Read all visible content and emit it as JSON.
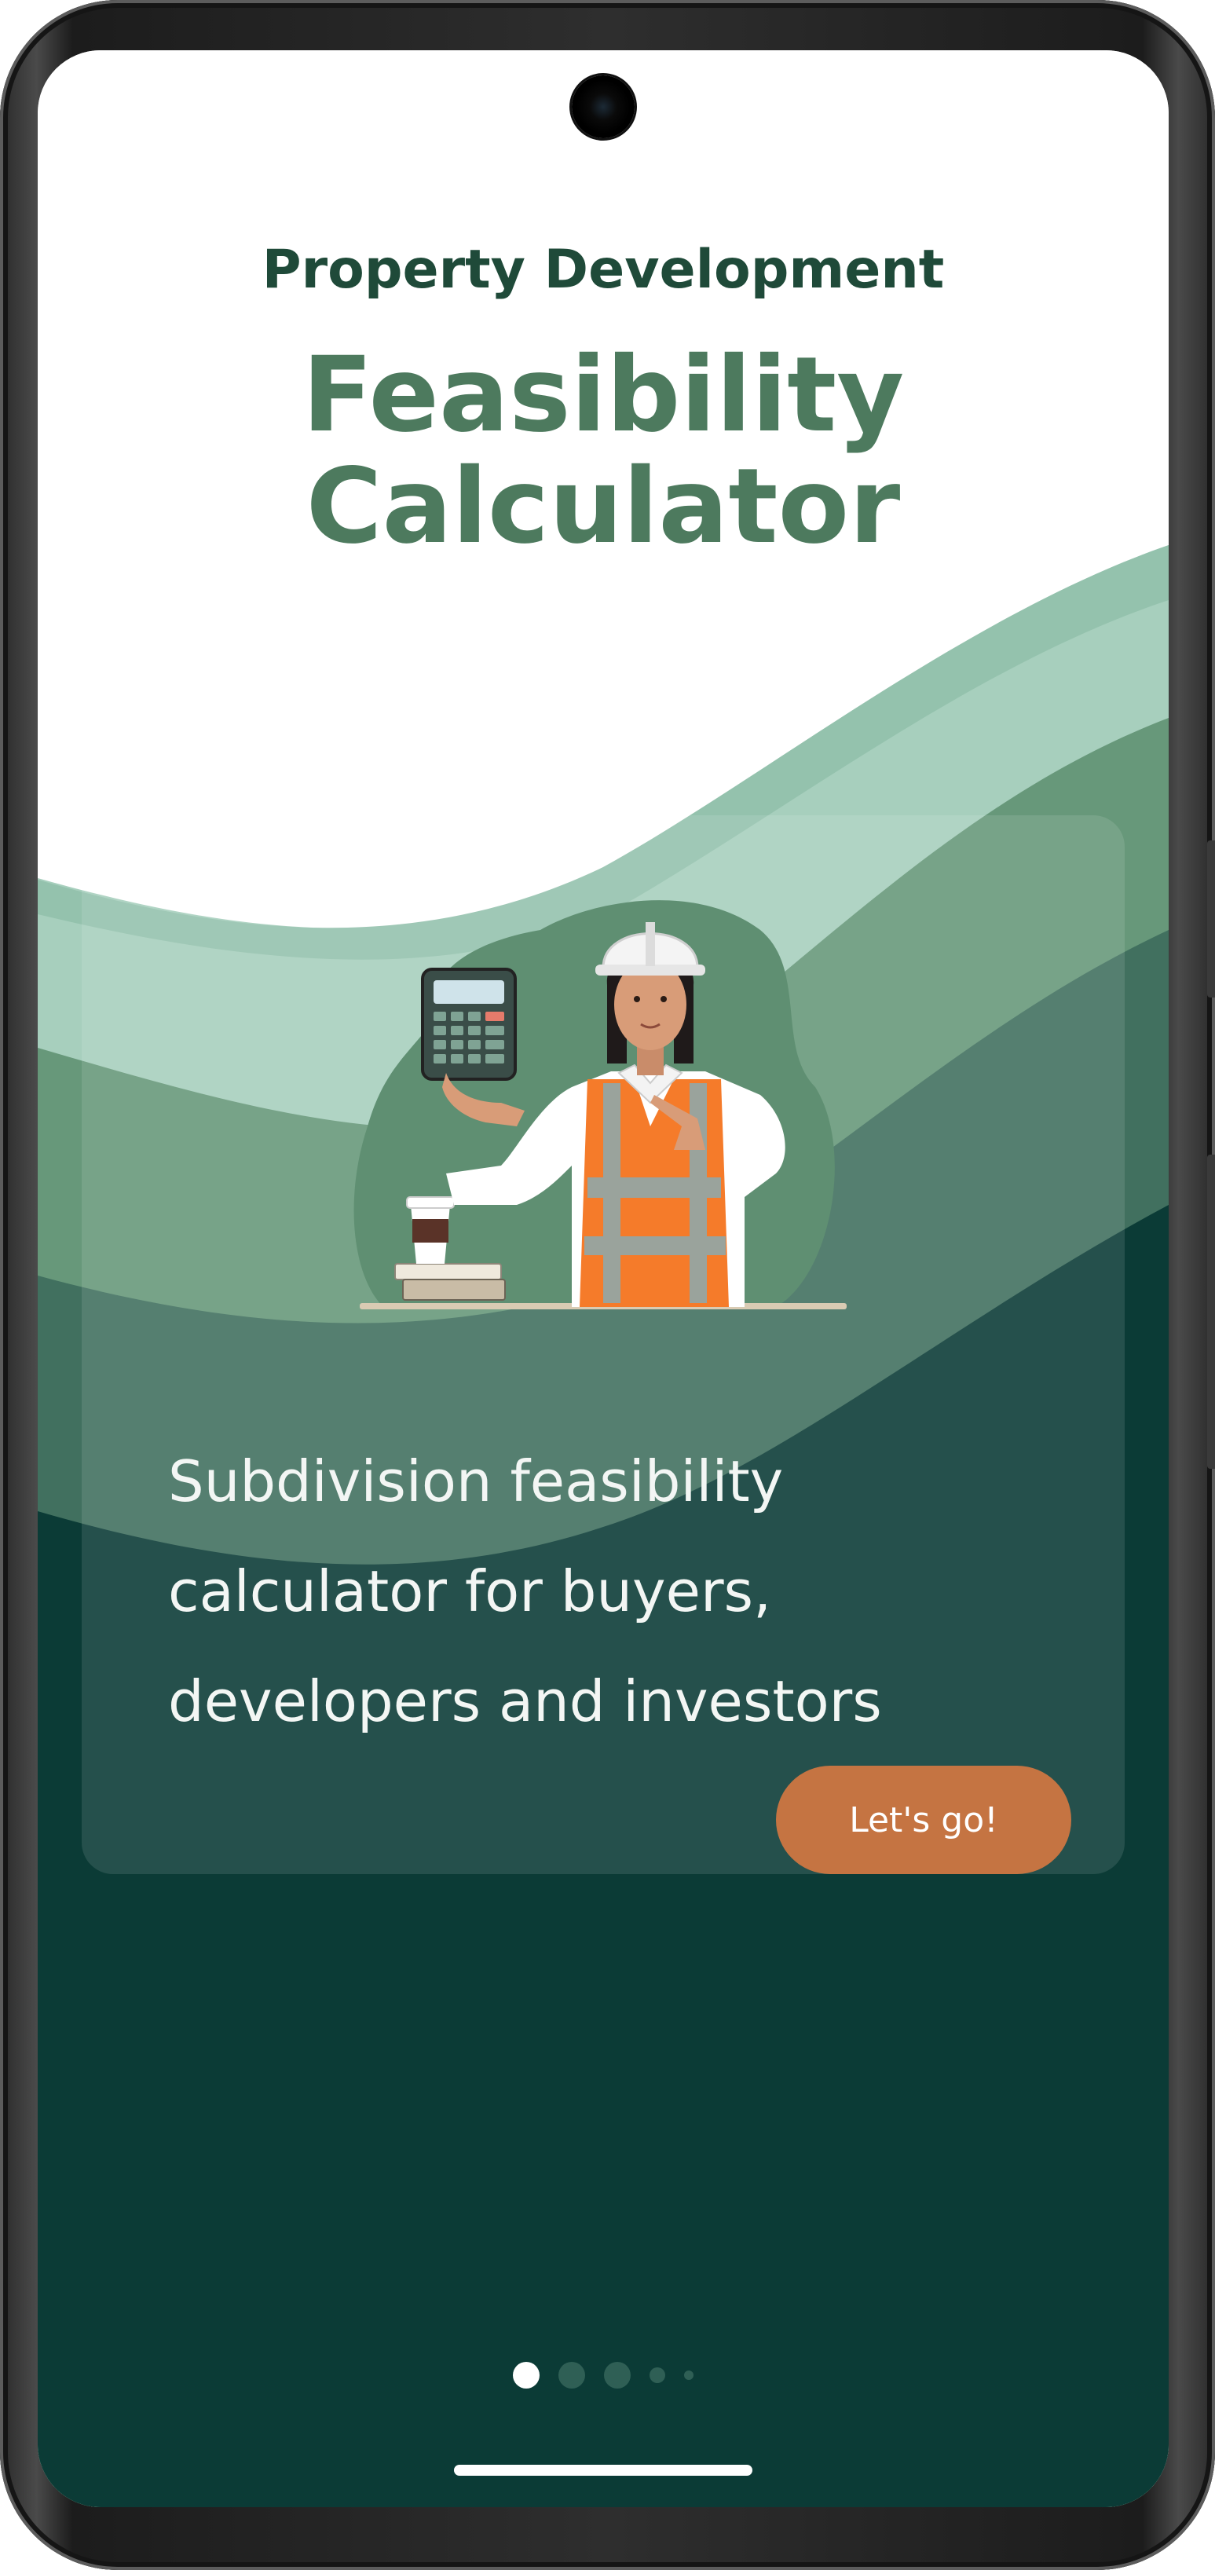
{
  "header": {
    "subtitle": "Property Development",
    "title_line1": "Feasibility",
    "title_line2": "Calculator"
  },
  "main": {
    "description_lines": [
      "Subdivision feasibility",
      "calculator for buyers,",
      "developers and investors"
    ],
    "cta_label": "Let's go!"
  },
  "pagination": {
    "total": 5,
    "active_index": 0
  },
  "icons": {
    "illustration": "engineer-with-calculator-illustration",
    "camera": "front-camera"
  },
  "colors": {
    "title_dark": "#1f4a39",
    "title_green": "#4d7a5e",
    "cta": "#c57442",
    "background_dark": "#0b3b36"
  }
}
